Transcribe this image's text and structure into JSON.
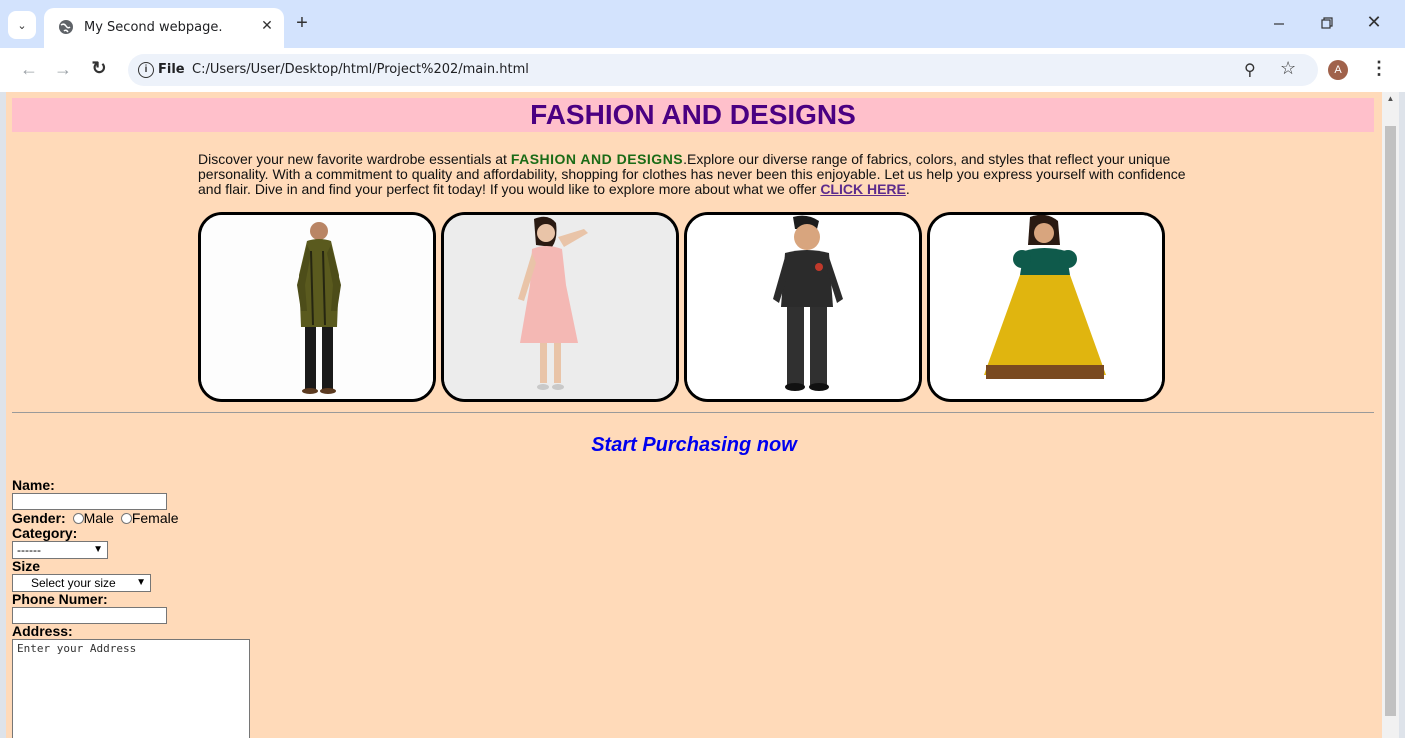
{
  "browser": {
    "tab_title": "My Second webpage.",
    "scheme_label": "File",
    "url": "C:/Users/User/Desktop/html/Project%202/main.html",
    "avatar_letter": "A"
  },
  "page": {
    "title": "FASHION AND DESIGNS",
    "intro": {
      "before": "Discover your new favorite wardrobe essentials at ",
      "brand": "FASHION AND DESIGNS",
      "after": ".Explore our diverse range of fabrics, colors, and styles that reflect your unique personality. With a commitment to quality and affordability, shopping for clothes has never been this enjoyable. Let us help you express yourself with confidence and flair. Dive in and find your perfect fit today! If you would like to explore more about what we offer ",
      "link": "CLICK HERE",
      "end": "."
    },
    "gallery": [
      "man-sherwani-image",
      "woman-pink-dress-image",
      "boy-suit-image",
      "girl-lehenga-image"
    ],
    "subheading": "Start Purchasing now",
    "form": {
      "name_label": "Name:",
      "gender_label": "Gender:",
      "gender_options": [
        "Male",
        "Female"
      ],
      "category_label": "Category:",
      "category_selected": "------",
      "size_label": "Size",
      "size_selected": "Select your size",
      "phone_label": "Phone Numer:",
      "address_label": "Address:",
      "address_placeholder": "Enter your Address"
    }
  },
  "colors": {
    "page_bg": "#ffdab9",
    "banner_bg": "#ffc0cb",
    "title": "#4b0082",
    "brand": "#1a6b16",
    "link": "#5c2b8c",
    "subheading": "#0000ee"
  }
}
